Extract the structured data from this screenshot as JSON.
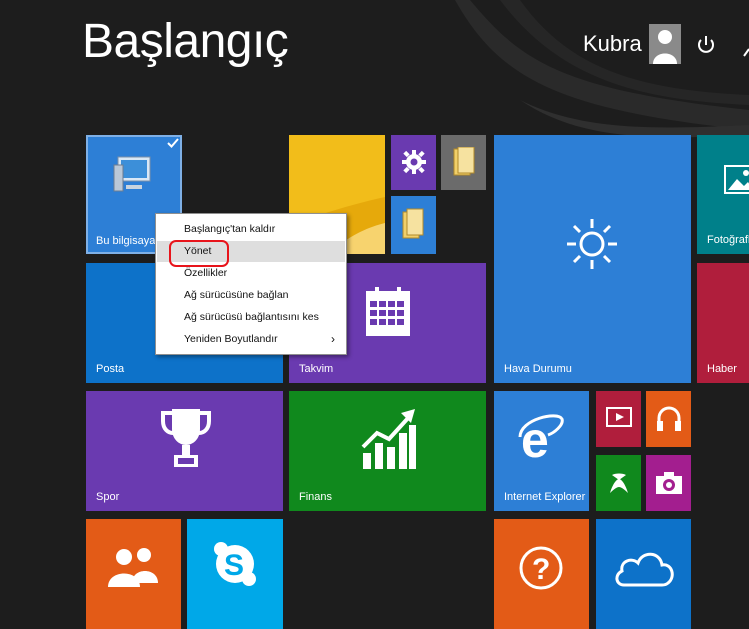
{
  "header": {
    "title": "Başlangıç"
  },
  "user": {
    "name": "Kubra"
  },
  "tiles": {
    "computer": "Bu bilgisayar",
    "posta": "Posta",
    "takvim": "Takvim",
    "hava": "Hava Durumu",
    "fotograflar": "Fotoğrafla",
    "haber": "Haber",
    "spor": "Spor",
    "finans": "Finans",
    "ie": "Internet Explorer"
  },
  "context_menu": {
    "items": [
      {
        "label": "Başlangıç'tan kaldır"
      },
      {
        "label": "Yönet"
      },
      {
        "label": "Özellikler"
      },
      {
        "label": "Ağ sürücüsüne bağlan"
      },
      {
        "label": "Ağ sürücüsü bağlantısını kes"
      },
      {
        "label": "Yeniden Boyutlandır",
        "arrow": "›"
      }
    ]
  },
  "colors": {
    "background": "#1d1d1d",
    "blue": "#2d7fd6",
    "purple": "#6a3ab0",
    "green": "#10891d",
    "orange": "#e35b17",
    "crimson": "#b01e3c",
    "teal": "#00808a",
    "yellow": "#e6a90b",
    "highlight": "#e8141b"
  }
}
